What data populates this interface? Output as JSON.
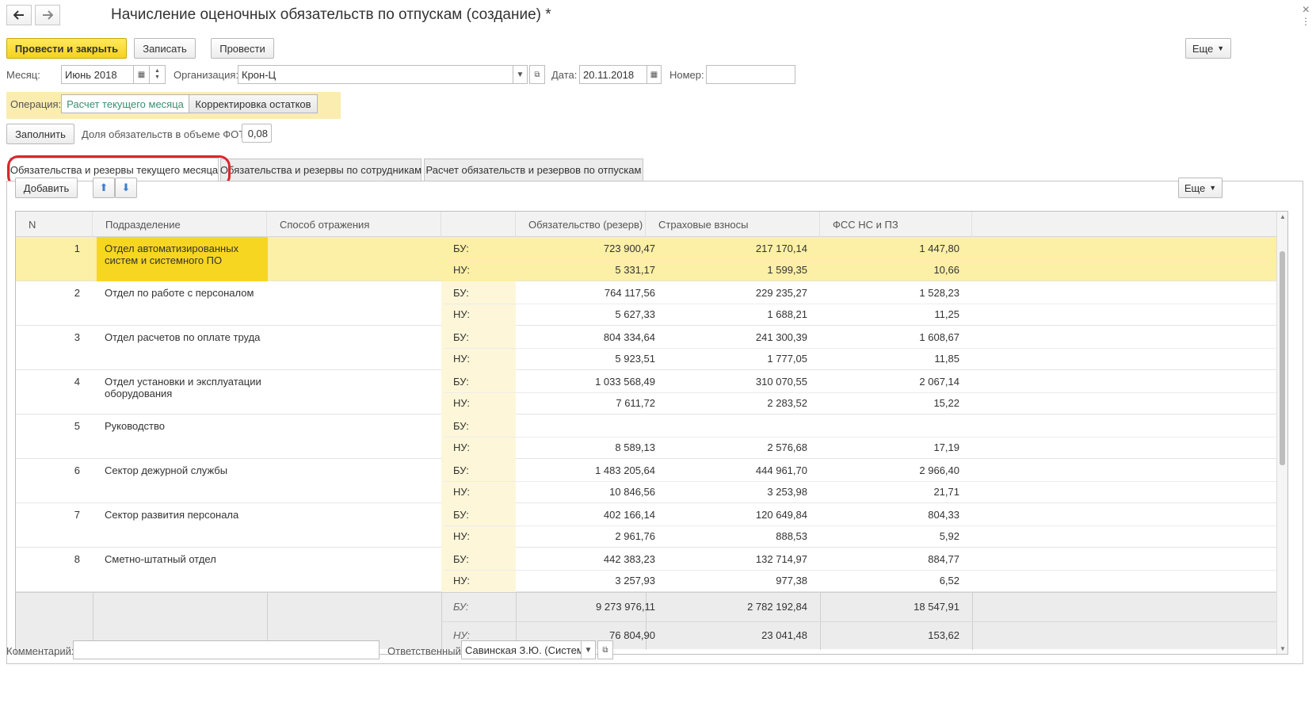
{
  "window": {
    "title": "Начисление оценочных обязательств по отпускам (создание) *",
    "back_icon": "arrow-left-icon",
    "forward_icon": "arrow-right-icon",
    "close_symbol": "×",
    "menu_symbol": "⋮"
  },
  "toolbar": {
    "post_close": "Провести и закрыть",
    "save": "Записать",
    "post": "Провести",
    "more": "Еще"
  },
  "fields": {
    "month_label": "Месяц:",
    "month_value": "Июнь 2018",
    "org_label": "Организация:",
    "org_value": "Крон-Ц",
    "date_label": "Дата:",
    "date_value": "20.11.2018",
    "number_label": "Номер:",
    "number_value": ""
  },
  "operation": {
    "label": "Операция:",
    "options": [
      "Расчет текущего месяца",
      "Корректировка остатков"
    ],
    "selected_index": 0
  },
  "fill": {
    "button": "Заполнить",
    "share_label": "Доля обязательств в объеме ФОТ:",
    "share_value": "0,08"
  },
  "tabs": [
    "Обязательства и резервы текущего месяца",
    "Обязательства и резервы по сотрудникам",
    "Расчет обязательств и резервов по отпускам"
  ],
  "table_toolbar": {
    "add": "Добавить",
    "more": "Еще"
  },
  "table": {
    "columns": [
      "N",
      "Подразделение",
      "Способ отражения",
      "",
      "Обязательство (резерв)",
      "Страховые взносы",
      "ФСС НС и ПЗ"
    ],
    "rows": [
      {
        "n": "1",
        "dept": [
          "Отдел автоматизированных",
          "систем и системного ПО"
        ],
        "bu_label": "БУ:",
        "nu_label": "НУ:",
        "bu": [
          "723 900,47",
          "217 170,14",
          "1 447,80"
        ],
        "nu": [
          "5 331,17",
          "1 599,35",
          "10,66"
        ]
      },
      {
        "n": "2",
        "dept": [
          "Отдел по работе с персоналом",
          ""
        ],
        "bu_label": "БУ:",
        "nu_label": "НУ:",
        "bu": [
          "764 117,56",
          "229 235,27",
          "1 528,23"
        ],
        "nu": [
          "5 627,33",
          "1 688,21",
          "11,25"
        ]
      },
      {
        "n": "3",
        "dept": [
          "Отдел расчетов по оплате труда",
          ""
        ],
        "bu_label": "БУ:",
        "nu_label": "НУ:",
        "bu": [
          "804 334,64",
          "241 300,39",
          "1 608,67"
        ],
        "nu": [
          "5 923,51",
          "1 777,05",
          "11,85"
        ]
      },
      {
        "n": "4",
        "dept": [
          "Отдел установки и эксплуатации",
          "оборудования"
        ],
        "bu_label": "БУ:",
        "nu_label": "НУ:",
        "bu": [
          "1 033 568,49",
          "310 070,55",
          "2 067,14"
        ],
        "nu": [
          "7 611,72",
          "2 283,52",
          "15,22"
        ]
      },
      {
        "n": "5",
        "dept": [
          "Руководство",
          ""
        ],
        "bu_label": "БУ:",
        "nu_label": "НУ:",
        "bu": [
          "",
          "",
          ""
        ],
        "nu": [
          "8 589,13",
          "2 576,68",
          "17,19"
        ]
      },
      {
        "n": "6",
        "dept": [
          "Сектор дежурной службы",
          ""
        ],
        "bu_label": "БУ:",
        "nu_label": "НУ:",
        "bu": [
          "1 483 205,64",
          "444 961,70",
          "2 966,40"
        ],
        "nu": [
          "10 846,56",
          "3 253,98",
          "21,71"
        ]
      },
      {
        "n": "7",
        "dept": [
          "Сектор развития персонала",
          ""
        ],
        "bu_label": "БУ:",
        "nu_label": "НУ:",
        "bu": [
          "402 166,14",
          "120 649,84",
          "804,33"
        ],
        "nu": [
          "2 961,76",
          "888,53",
          "5,92"
        ]
      },
      {
        "n": "8",
        "dept": [
          "Сметно-штатный отдел",
          ""
        ],
        "bu_label": "БУ:",
        "nu_label": "НУ:",
        "bu": [
          "442 383,23",
          "132 714,97",
          "884,77"
        ],
        "nu": [
          "3 257,93",
          "977,38",
          "6,52"
        ]
      }
    ],
    "totals": {
      "bu_label": "БУ:",
      "nu_label": "НУ:",
      "bu": [
        "9 273 976,11",
        "2 782 192,84",
        "18 547,91"
      ],
      "nu": [
        "76 804,90",
        "23 041,48",
        "153,62"
      ]
    }
  },
  "bottom": {
    "comment_label": "Комментарий:",
    "comment_value": "",
    "responsible_label": "Ответственный:",
    "responsible_value": "Савинская З.Ю. (Системн"
  },
  "colors": {
    "primary_button": "#f7d21c",
    "selected_row": "#fcefa6",
    "selected_cell": "#f7d622",
    "tab_highlight": "#d9262e",
    "operation_panel": "#fbecb0"
  }
}
